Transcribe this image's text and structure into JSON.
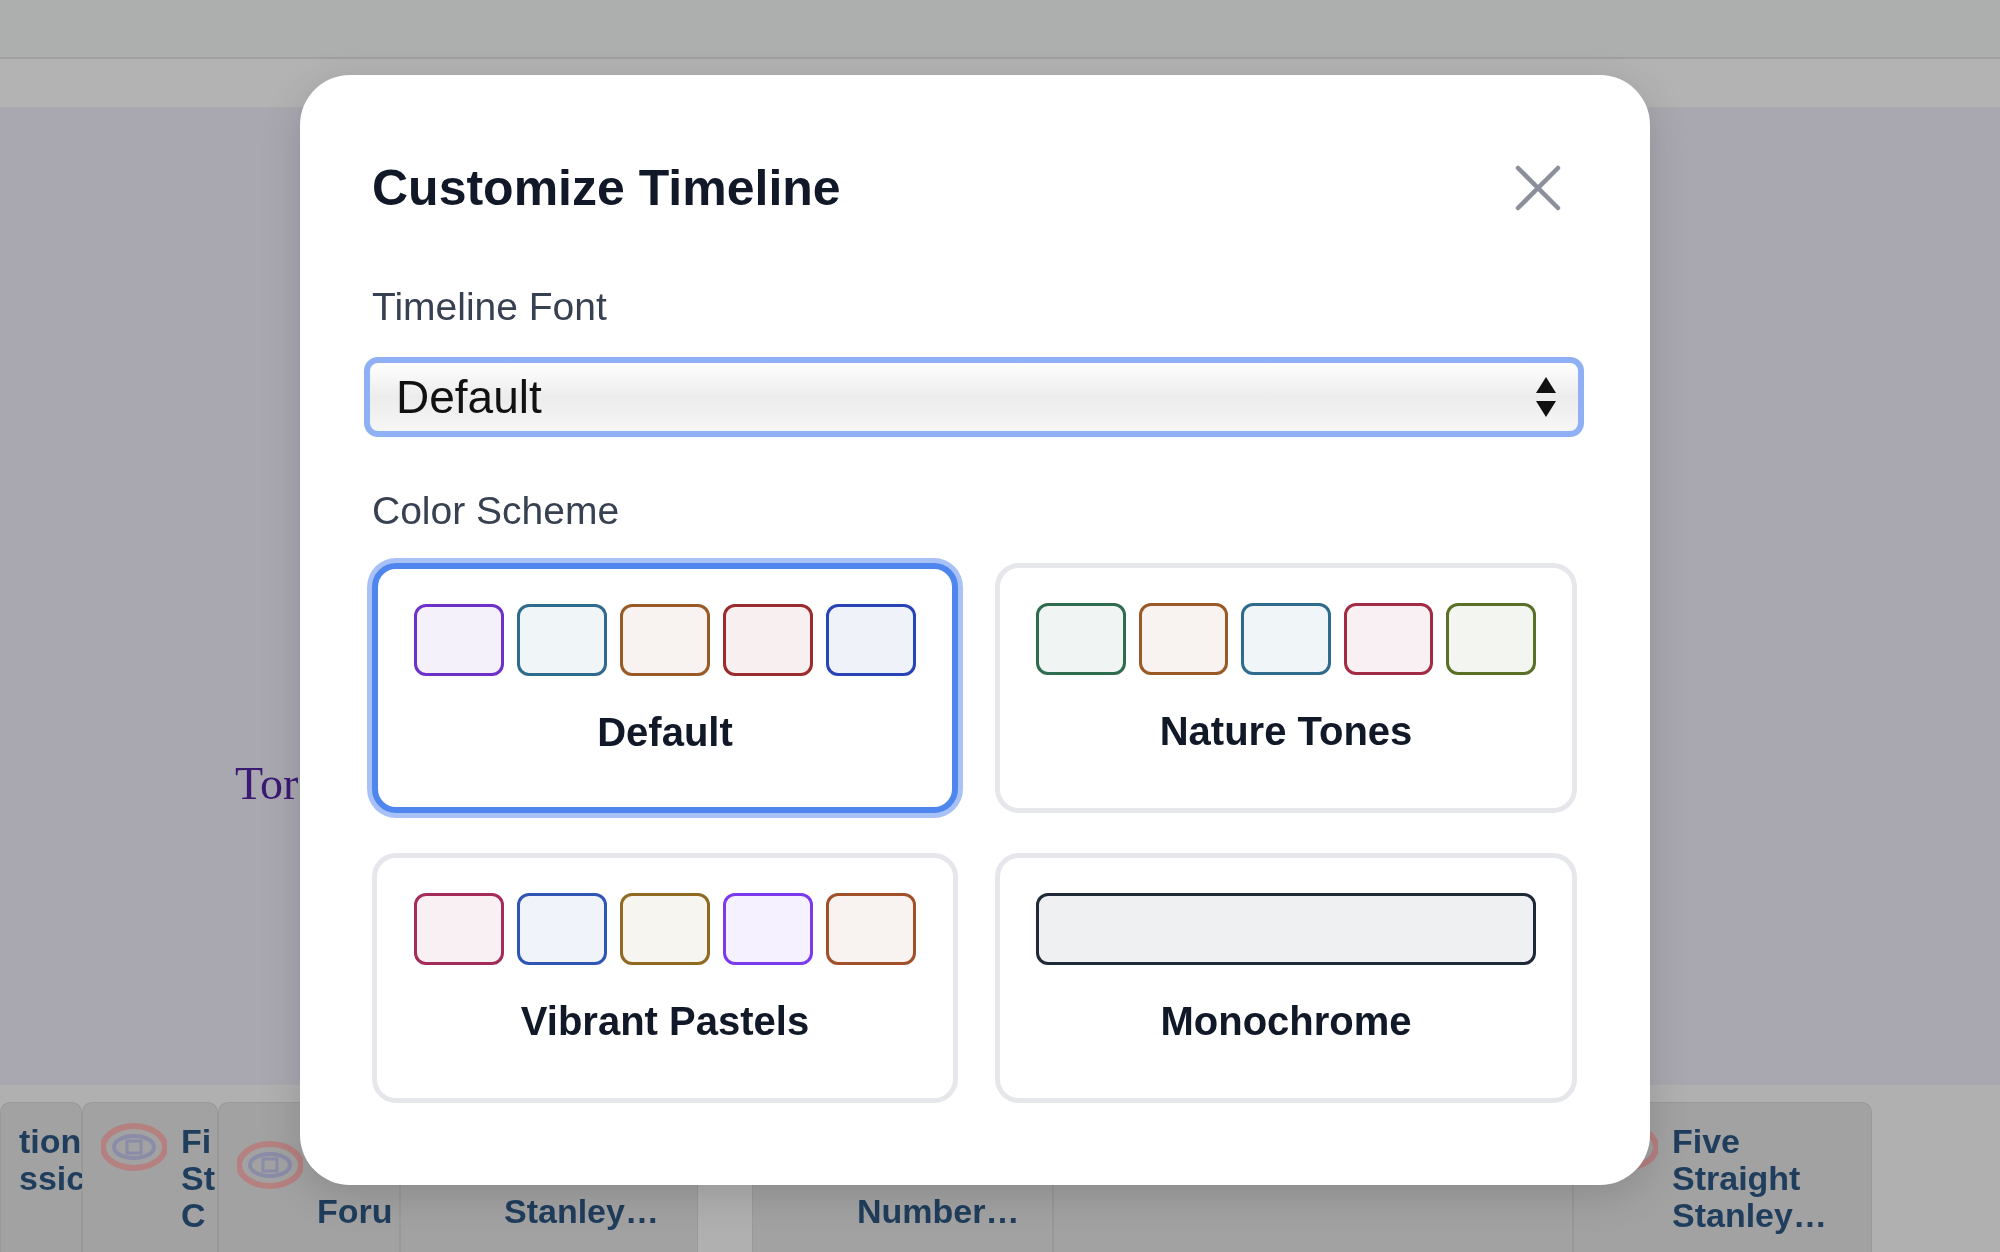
{
  "background": {
    "subtitle": "Tor",
    "cards": [
      {
        "kind": "full",
        "lines": [
          "tion",
          "ssic"
        ],
        "logo": false
      },
      {
        "kind": "full",
        "lines": [
          "Fi",
          "St",
          "C"
        ],
        "logo": true
      },
      {
        "kind": "clipped",
        "lines": [
          "Foru"
        ],
        "logo": true
      },
      {
        "kind": "clipped",
        "lines": [
          "Stanley…"
        ],
        "logo": false
      },
      {
        "kind": "clipped",
        "lines": [
          "Number…"
        ],
        "logo": false
      },
      {
        "kind": "full",
        "logo": false
      },
      {
        "kind": "full",
        "lines": [
          "Five",
          "Straight",
          "Stanley…"
        ],
        "logo": true
      }
    ]
  },
  "dialog": {
    "title": "Customize Timeline",
    "font_label": "Timeline Font",
    "font_select": {
      "value": "Default"
    },
    "scheme_label": "Color Scheme",
    "schemes": [
      {
        "name": "Default",
        "selected": true,
        "swatches": [
          {
            "color": "#6d31c9"
          },
          {
            "color": "#2f6b8c"
          },
          {
            "color": "#9a5a26"
          },
          {
            "color": "#9b2c2c"
          },
          {
            "color": "#2844b5"
          }
        ]
      },
      {
        "name": "Nature Tones",
        "selected": false,
        "swatches": [
          {
            "color": "#2f6b4f"
          },
          {
            "color": "#9a5a26"
          },
          {
            "color": "#2f6b8c"
          },
          {
            "color": "#a12c44"
          },
          {
            "color": "#5a7026"
          }
        ]
      },
      {
        "name": "Vibrant Pastels",
        "selected": false,
        "swatches": [
          {
            "color": "#a32c5a"
          },
          {
            "color": "#2f55b5"
          },
          {
            "color": "#8f6a20"
          },
          {
            "color": "#7c3aed"
          },
          {
            "color": "#a2502a"
          }
        ]
      },
      {
        "name": "Monochrome",
        "selected": false,
        "swatches": [
          {
            "color": "#1f2937"
          }
        ]
      }
    ]
  }
}
